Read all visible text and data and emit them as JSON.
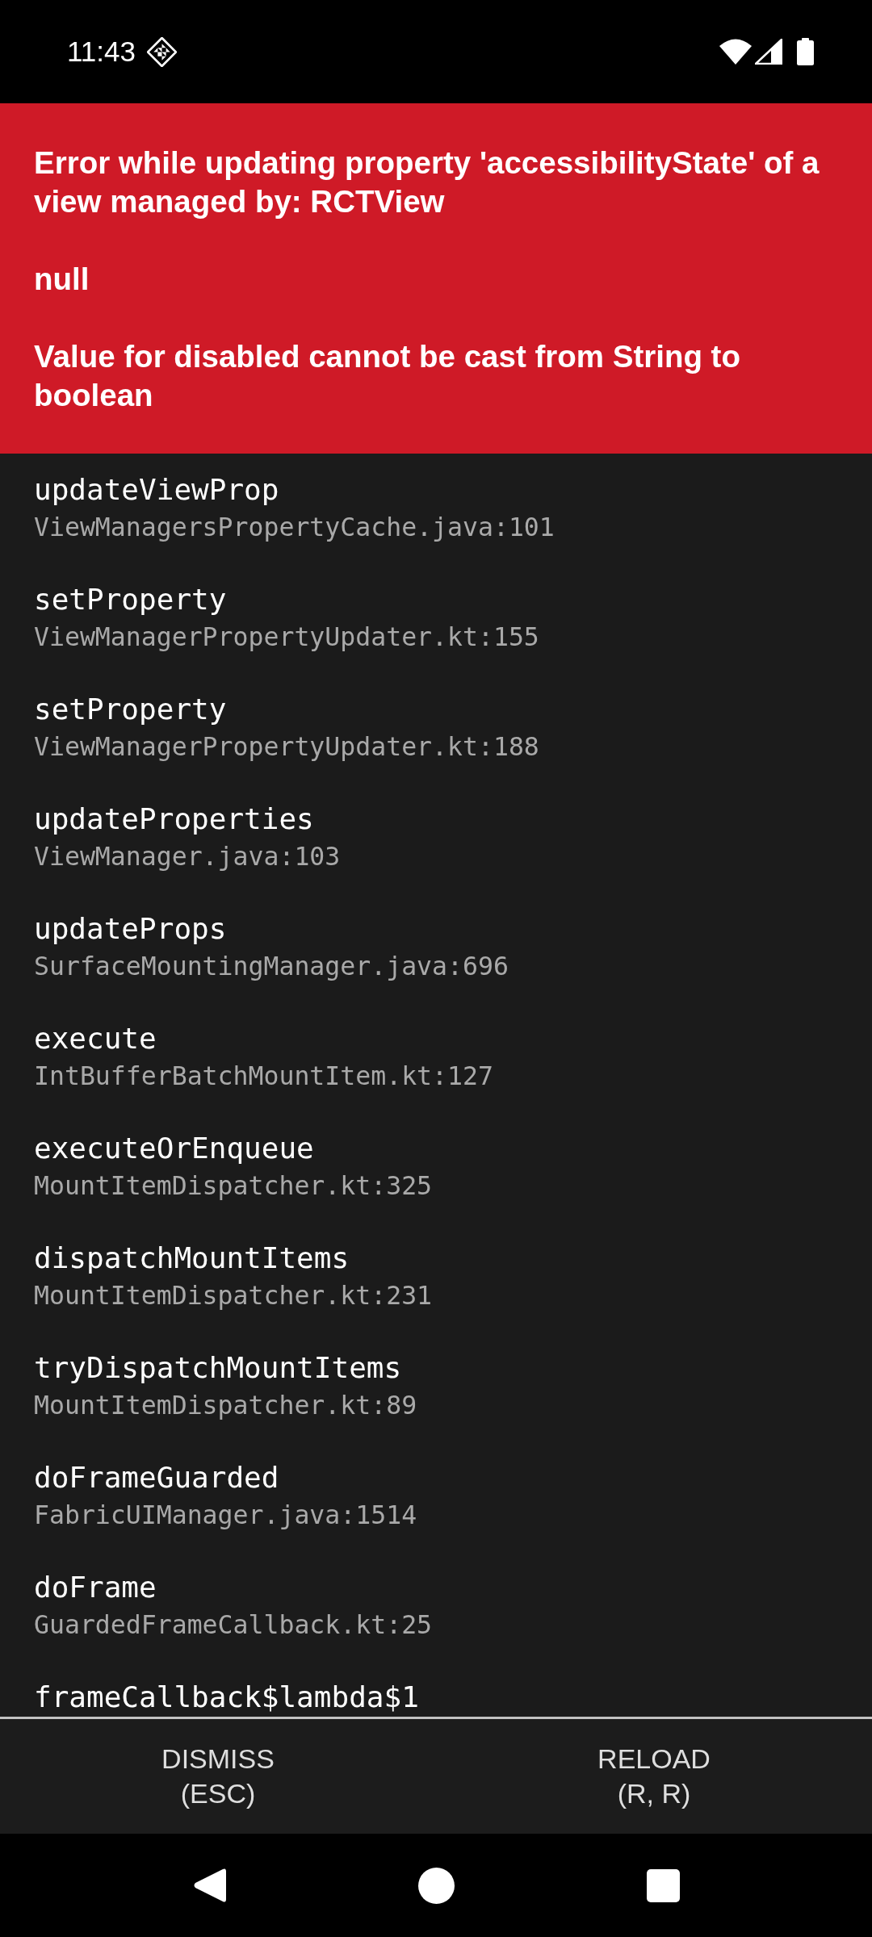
{
  "status_bar": {
    "time": "11:43"
  },
  "error": {
    "paragraphs": [
      "Error while updating property 'accessibilityState' of a view managed by: RCTView",
      "null",
      "Value for disabled cannot be cast from String to boolean"
    ]
  },
  "stack": [
    {
      "method": "updateViewProp",
      "file": "ViewManagersPropertyCache.java:101"
    },
    {
      "method": "setProperty",
      "file": "ViewManagerPropertyUpdater.kt:155"
    },
    {
      "method": "setProperty",
      "file": "ViewManagerPropertyUpdater.kt:188"
    },
    {
      "method": "updateProperties",
      "file": "ViewManager.java:103"
    },
    {
      "method": "updateProps",
      "file": "SurfaceMountingManager.java:696"
    },
    {
      "method": "execute",
      "file": "IntBufferBatchMountItem.kt:127"
    },
    {
      "method": "executeOrEnqueue",
      "file": "MountItemDispatcher.kt:325"
    },
    {
      "method": "dispatchMountItems",
      "file": "MountItemDispatcher.kt:231"
    },
    {
      "method": "tryDispatchMountItems",
      "file": "MountItemDispatcher.kt:89"
    },
    {
      "method": "doFrameGuarded",
      "file": "FabricUIManager.java:1514"
    },
    {
      "method": "doFrame",
      "file": "GuardedFrameCallback.kt:25"
    },
    {
      "method": "frameCallback$lambda$1"
    }
  ],
  "buttons": [
    {
      "label": "DISMISS\n(ESC)"
    },
    {
      "label": "RELOAD\n(R, R)"
    }
  ]
}
